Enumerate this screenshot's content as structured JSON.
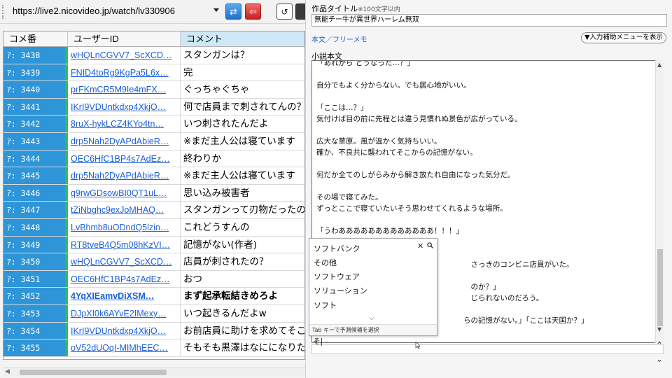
{
  "toolbar": {
    "url": "https://live2.nicovideo.jp/watch/lv330906",
    "blue_button_glyph": "⇄",
    "red_button_glyph": "⇦",
    "undo_glyph": "↺"
  },
  "grid": {
    "headers": {
      "no": "コメ番",
      "uid": "ユーザーID",
      "comment": "コメント"
    },
    "rows": [
      {
        "no": "ｱ: 3438",
        "uid": "wHQLnCGVV7_ScXCD…",
        "comment": "スタンガンは？",
        "bold": false
      },
      {
        "no": "ｱ: 3439",
        "uid": "FNID4toRg9KgPa5L6x…",
        "comment": "完",
        "bold": false
      },
      {
        "no": "ｱ: 3440",
        "uid": "prFKmCR5M9Ie4mFX…",
        "comment": "ぐっちゃぐちゃ",
        "bold": false
      },
      {
        "no": "ｱ: 3441",
        "uid": "IKrI9VDUntkdxp4XkjO…",
        "comment": "何で店員まで刺されてんの？",
        "bold": false
      },
      {
        "no": "ｱ: 3442",
        "uid": "8ruX-hykLCZ4KYo4tn…",
        "comment": "いつ刺されたんだよ",
        "bold": false
      },
      {
        "no": "ｱ: 3443",
        "uid": "drp5Nah2DyAPdAbieR…",
        "comment": "※まだ主人公は寝ています",
        "bold": false
      },
      {
        "no": "ｱ: 3444",
        "uid": "OEC6HfC1BP4s7AdEz…",
        "comment": "終わりか",
        "bold": false
      },
      {
        "no": "ｱ: 3445",
        "uid": "drp5Nah2DyAPdAbieR…",
        "comment": "※まだ主人公は寝ています",
        "bold": false
      },
      {
        "no": "ｱ: 3446",
        "uid": "q9rwGDsowBI0QT1uL…",
        "comment": "思い込み被害者",
        "bold": false
      },
      {
        "no": "ｱ: 3447",
        "uid": "tZiNbghc9exJoMHAQ…",
        "comment": "スタンガンって刃物だったのかよ",
        "bold": false
      },
      {
        "no": "ｱ: 3448",
        "uid": "LvBhmb8uODndQ5lzin…",
        "comment": "これどうすんの",
        "bold": false
      },
      {
        "no": "ｱ: 3449",
        "uid": "RT8tveB4Q5m08hKzVI…",
        "comment": "記憶がない(作者)",
        "bold": false
      },
      {
        "no": "ｱ: 3450",
        "uid": "wHQLnCGVV7_ScXCD…",
        "comment": "店員が刺されたの？",
        "bold": false
      },
      {
        "no": "ｱ: 3451",
        "uid": "OEC6HfC1BP4s7AdEz…",
        "comment": "おつ",
        "bold": false
      },
      {
        "no": "ｱ: 3452",
        "uid": "4YqXIEamvDiXSM…",
        "comment": "まず起承転結きめろよ",
        "bold": true
      },
      {
        "no": "ｱ: 3453",
        "uid": "DJpXI0k6AYvE2IMexy…",
        "comment": "いつ起きるんだよw",
        "bold": false
      },
      {
        "no": "ｱ: 3454",
        "uid": "IKrI9VDUntkdxp4XkjO…",
        "comment": "お前店員に助けを求めてそこで",
        "bold": false
      },
      {
        "no": "ｱ: 3455",
        "uid": "oV52dUOqI-MIMhEEC…",
        "comment": "そもそも黒澤はなにになりたい",
        "bold": false
      }
    ]
  },
  "right": {
    "title_label": "作品タイトル",
    "title_limit": "※100文字以内",
    "title_value": "無能チー牛が異世界ハーレム無双",
    "tabs": "本文／フリーメモ",
    "menu_button": "▼入力補助メニューを表示",
    "novel_label": "小説本文",
    "editor_lines": [
      "「あれから どうなった…？」",
      "",
      "自分でもよく分からない。でも居心地がいい。",
      "",
      "「ここは…？」",
      "気付けば目の前に先程とは違う見慣れぬ景色が広がっている。",
      "",
      "広大な草原。風が温かく気持ちいい。",
      "確か、不良共に襲われてそこからの記憶がない。",
      "",
      "何だか全てのしがらみから解き放たれ自由になった気分だ。",
      "",
      "その場で寝てみた。",
      "ずっとここで寝ていたいそう思わせてくれるような場所。",
      "",
      "「うわあああああああああああああ！！！」",
      "",
      "",
      "　　　　　　　　　　　　　　　　　　　　　さっきのコンビニ店員がいた。",
      "",
      "　　　　　　　　　　　　　　　　　　　　　のか？」",
      "　　　　　　　　　　　　　　　　　　　　　じられないのだろう。",
      "",
      "　　　　　　　　　　　　　　　　　　　　らの記憶がない。」「ここは天国か？」"
    ],
    "autocomplete": {
      "items": [
        "ソフトバンク",
        "その他",
        "ソフトウェア",
        "ソリューション",
        "ソフト"
      ],
      "close": "✕",
      "more": "⌵",
      "footer": "Tab キーで予測候補を選択",
      "typed": "そ|"
    }
  }
}
